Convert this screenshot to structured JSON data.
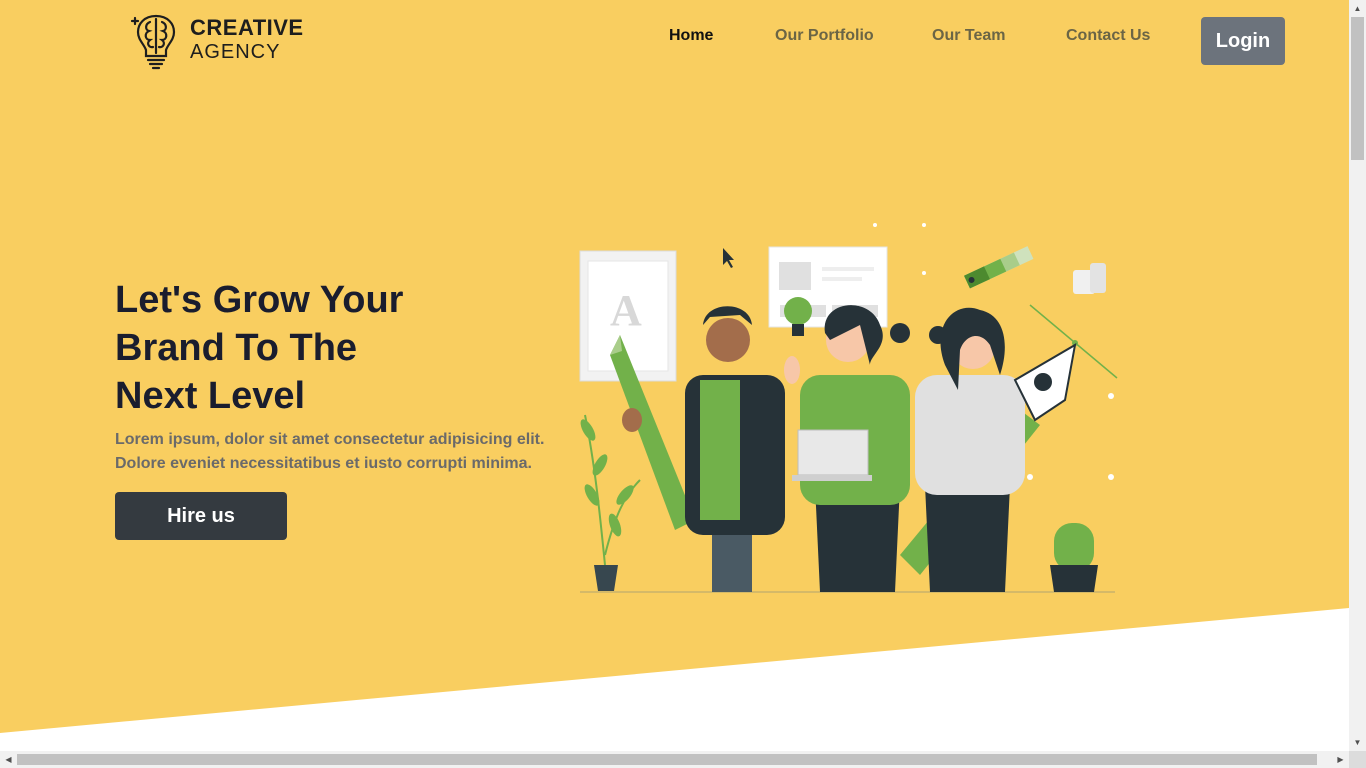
{
  "brand": {
    "line1": "CREATIVE",
    "line2": "AGENCY",
    "icon": "brain-bulb-icon"
  },
  "nav": {
    "items": [
      {
        "label": "Home",
        "active": true
      },
      {
        "label": "Our Portfolio",
        "active": false
      },
      {
        "label": "Our Team",
        "active": false
      },
      {
        "label": "Contact Us",
        "active": false
      }
    ],
    "login_label": "Login"
  },
  "hero": {
    "title_lines": [
      "Let's Grow Your",
      "Brand To The",
      "Next Level"
    ],
    "text_lines": [
      "Lorem ipsum, dolor sit amet consectetur adipisicing elit.",
      "Dolore eveniet necessitatibus et iusto corrupti minima."
    ],
    "cta_label": "Hire us",
    "illustration": "team-with-design-tools-illustration"
  },
  "colors": {
    "hero_bg": "#f9ce60",
    "dark_button": "#343a40",
    "login_button": "#6c737c",
    "accent_green": "#72b14a"
  }
}
